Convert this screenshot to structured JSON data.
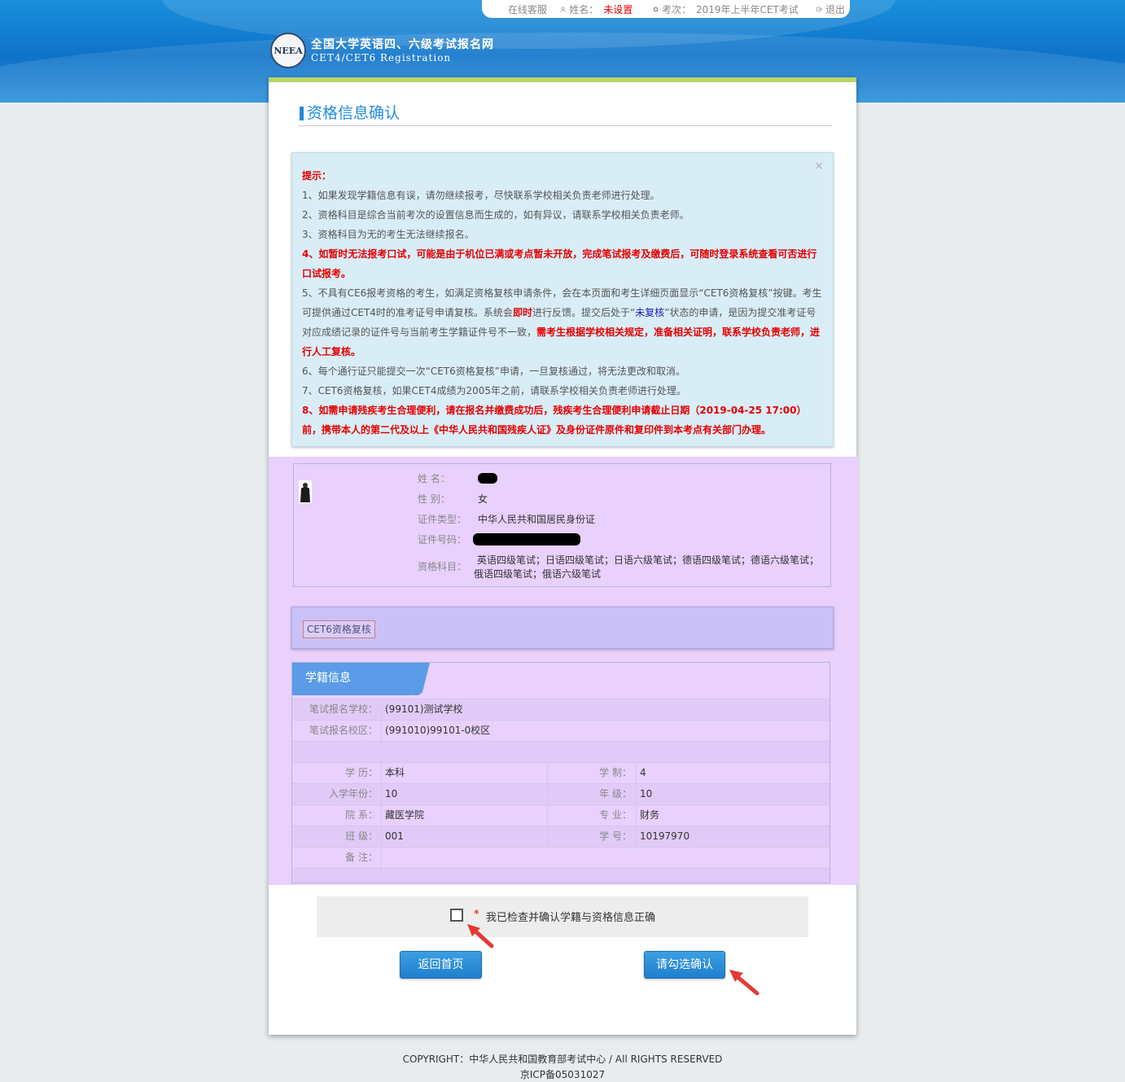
{
  "topbar": {
    "service": "在线客服",
    "name_label": "姓名：",
    "name_value": "未设置",
    "exam_label": "考次：",
    "exam_value": "2019年上半年CET考试",
    "logout": "退出"
  },
  "header": {
    "logo_badge": "NEEA",
    "site_title": "全国大学英语四、六级考试报名网",
    "site_subtitle": "CET4/CET6  Registration"
  },
  "page_title": "资格信息确认",
  "notice": {
    "close": "×",
    "heading": "提示：",
    "item1": "1、如果发现学籍信息有误，请勿继续报考，尽快联系学校相关负责老师进行处理。",
    "item2": "2、资格科目是综合当前考次的设置信息而生成的，如有异议，请联系学校相关负责老师。",
    "item3": "3、资格科目为无的考生无法继续报名。",
    "item4": "4、如暂时无法报考口试，可能是由于机位已满或考点暂未开放，完成笔试报考及缴费后，可随时登录系统查看可否进行口试报考。",
    "item5a": "5、不具有CE6报考资格的考生，如满足资格复核申请条件，会在本页面和考生详细页面显示“CET6资格复核”按键。考生可提供通过CET4时的准考证号申请复核。系统会",
    "item5b": "即时",
    "item5c": "进行反馈。提交后处于“",
    "item5d": "未复核",
    "item5e": "”状态的申请，是因为提交准考证号对应成绩记录的证件号与当前考生学籍证件号不一致，",
    "item5f": "需考生根据学校相关规定，准备相关证明，联系学校负责老师，进行人工复核。",
    "item6": "6、每个通行证只能提交一次“CET6资格复核”申请，一旦复核通过，将无法更改和取消。",
    "item7": "7、CET6资格复核，如果CET4成绩为2005年之前，请联系学校相关负责老师进行处理。",
    "item8": "8、如需申请残疾考生合理便利，请在报名并缴费成功后，残疾考生合理便利申请截止日期（2019-04-25 17:00）前，携带本人的第二代及以上《中华人民共和国残疾人证》及身份证件原件和复印件到本考点有关部门办理。"
  },
  "person": {
    "name_label": "姓    名：",
    "gender_label": "性    别：",
    "gender_value": "女",
    "idtype_label": "证件类型：",
    "idtype_value": "中华人民共和国居民身份证",
    "idno_label": "证件号码：",
    "subjects_label": "资格科目：",
    "subjects_line1": "英语四级笔试；日语四级笔试；日语六级笔试；德语四级笔试；德语六级笔试；",
    "subjects_line2": "俄语四级笔试；俄语六级笔试"
  },
  "recheck_button": "CET6资格复核",
  "xueji": {
    "tab": "学籍信息",
    "school_label": "笔试报名学校：",
    "school_value": "(99101)测试学校",
    "campus_label": "笔试报名校区：",
    "campus_value": "(991010)99101-0校区",
    "edu_label": "学    历：",
    "edu_value": "本科",
    "length_label": "学    制：",
    "length_value": "4",
    "year_label": "入学年份：",
    "year_value": "10",
    "grade_label": "年    级：",
    "grade_value": "10",
    "dept_label": "院    系：",
    "dept_value": "藏医学院",
    "major_label": "专    业：",
    "major_value": "财务",
    "class_label": "班    级：",
    "class_value": "001",
    "stuno_label": "学    号：",
    "stuno_value": "10197970",
    "remark_label": "备    注：",
    "remark_value": ""
  },
  "confirm": {
    "star": "*",
    "label": "我已检查并确认学籍与资格信息正确"
  },
  "buttons": {
    "home": "返回首页",
    "confirm": "请勾选确认"
  },
  "footer": {
    "copyright": "COPYRIGHT：中华人民共和国教育部考试中心 / All RIGHTS RESERVED",
    "icp": "京ICP备05031027"
  },
  "colors": {
    "accent_blue": "#1f8ce0",
    "warning_red": "#e60000",
    "highlight_purple": "#e9d0fd"
  }
}
